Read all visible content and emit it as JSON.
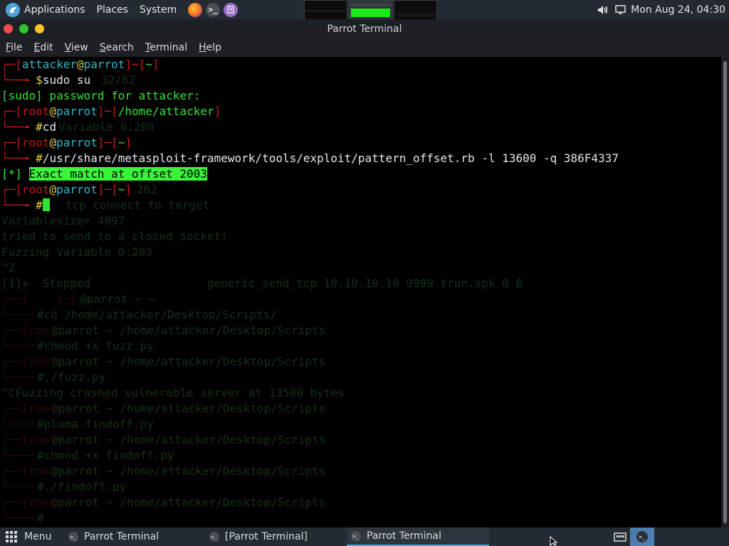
{
  "top_panel": {
    "apps_label": "Applications",
    "places_label": "Places",
    "system_label": "System",
    "launchers": [
      "firefox-icon",
      "terminal-icon",
      "text-editor-icon"
    ],
    "clock": "Mon Aug 24, 04:30"
  },
  "window": {
    "title": "Parrot Terminal",
    "menu": [
      "File",
      "Edit",
      "View",
      "Search",
      "Terminal",
      "Help"
    ]
  },
  "terminal": {
    "prompt1": {
      "user": "attacker",
      "host": "parrot",
      "path": "~",
      "sym": "$",
      "cmd": "sudo su"
    },
    "sudo_msg": "[sudo] password for attacker:",
    "prompt2": {
      "user": "root",
      "host": "parrot",
      "path": "/home/attacker",
      "sym": "#",
      "cmd": "cd"
    },
    "prompt3": {
      "user": "root",
      "host": "parrot",
      "path": "~",
      "sym": "#",
      "cmd": "/usr/share/metasploit-framework/tools/exploit/pattern_offset.rb -l 13600 -q 386F4337"
    },
    "result_tag": "[*]",
    "result_text": "Exact match at offset 2003",
    "prompt4": {
      "user": "root",
      "host": "parrot",
      "path": "~",
      "sym": "#"
    },
    "ghost": {
      "g1": "32/62",
      "g2": "Variable 0:200",
      "g3": "262",
      "g4": "tcp connect to target",
      "g5": "Variablesize= 4097",
      "g6": "tried to send to a closed socket!",
      "g7": "Fuzzing Variable 0:203",
      "g8": "^Z",
      "g9": "[1]+  Stopped                 generic_send_tcp 10.10.10.10 9999 trun.spk 0 0",
      "g10": "@parrot ~ ~",
      "g11": "#cd /home/attacker/Desktop/Scripts/",
      "g12": "@parrot ~ /home/attacker/Desktop/Scripts",
      "g13": "#chmod +x fuzz.py",
      "g14": "@parrot ~ /home/attacker/Desktop/Scripts",
      "g15": "#./fuzz.py",
      "g16": "^CFuzzing crashed vulnerable server at 13500 bytes",
      "g17": "@parrot ~ /home/attacker/Desktop/Scripts",
      "g18": "#pluma findoff.py",
      "g19": "@parrot ~ /home/attacker/Desktop/Scripts",
      "g20": "#chmod +x findoff.py",
      "g21": "@parrot ~ /home/attacker/Desktop/Scripts",
      "g22": "#./findoff.py",
      "g23": "@parrot ~ /home/attacker/Desktop/Scripts",
      "g24": "#"
    }
  },
  "taskbar": {
    "menu_label": "Menu",
    "tasks": [
      "Parrot Terminal",
      "[Parrot Terminal]",
      "Parrot Terminal"
    ]
  },
  "colors": {
    "prompt_red": "#c8151b",
    "user_cyan": "#2fb9c9",
    "text_green": "#32e232",
    "highlight": "#39f539"
  }
}
